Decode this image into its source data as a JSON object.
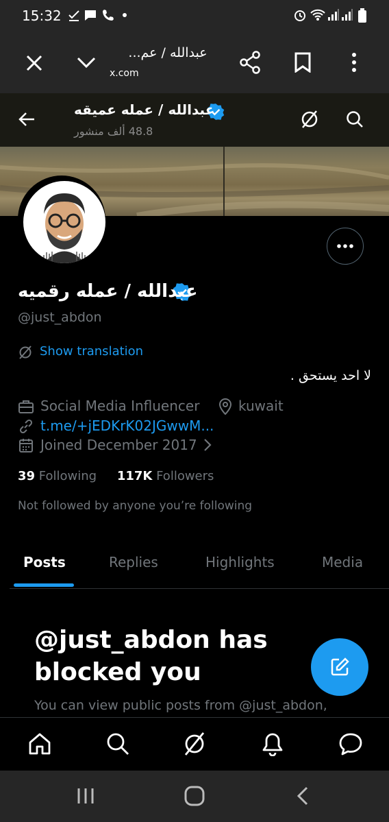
{
  "status_bar": {
    "time": "15:32",
    "left_icons": [
      "check-icon",
      "chat-icon",
      "call-icon",
      "dot-icon"
    ],
    "right_icons": [
      "alarm-icon",
      "wifi-icon",
      "signal-icon",
      "signal-icon",
      "battery-icon"
    ]
  },
  "browser": {
    "title": "عبدالله / عم...",
    "domain": "x.com",
    "icons": [
      "close-icon",
      "chevron-down-icon",
      "share-icon",
      "bookmark-icon",
      "more-vertical-icon"
    ]
  },
  "header": {
    "title": "عبدالله / عمله عميقه",
    "posts_count": "48.8 ألف منشور",
    "icons": [
      "back-arrow-icon",
      "verified-badge-icon",
      "grok-icon",
      "search-icon"
    ]
  },
  "profile": {
    "display_name": "عبدالله / عمله رقميه",
    "handle": "@just_abdon",
    "show_translation": "Show translation",
    "bio": "لا احد يستحق .",
    "category": "Social Media Influencer",
    "location": "kuwait",
    "link": "t.me/+jEDKrK02JGwwM...",
    "joined": "Joined December 2017",
    "following_count": "39",
    "following_label": "Following",
    "followers_count": "117K",
    "followers_label": "Followers",
    "not_followed": "Not followed by anyone you’re following"
  },
  "tabs": [
    {
      "label": "Posts",
      "active": true
    },
    {
      "label": "Replies",
      "active": false
    },
    {
      "label": "Highlights",
      "active": false
    },
    {
      "label": "Media",
      "active": false
    }
  ],
  "blocked": {
    "title": "@just_abdon has blocked you",
    "description": "You can view public posts from @just_abdon,"
  },
  "bottom_nav": [
    "home-icon",
    "search-icon",
    "grok-icon",
    "notifications-icon",
    "messages-icon"
  ],
  "system_nav": [
    "recents-icon",
    "home-button-icon",
    "back-icon"
  ],
  "colors": {
    "accent": "#1d9bf0",
    "background": "#000000",
    "muted_text": "#71767b",
    "bar_background": "#262626"
  }
}
